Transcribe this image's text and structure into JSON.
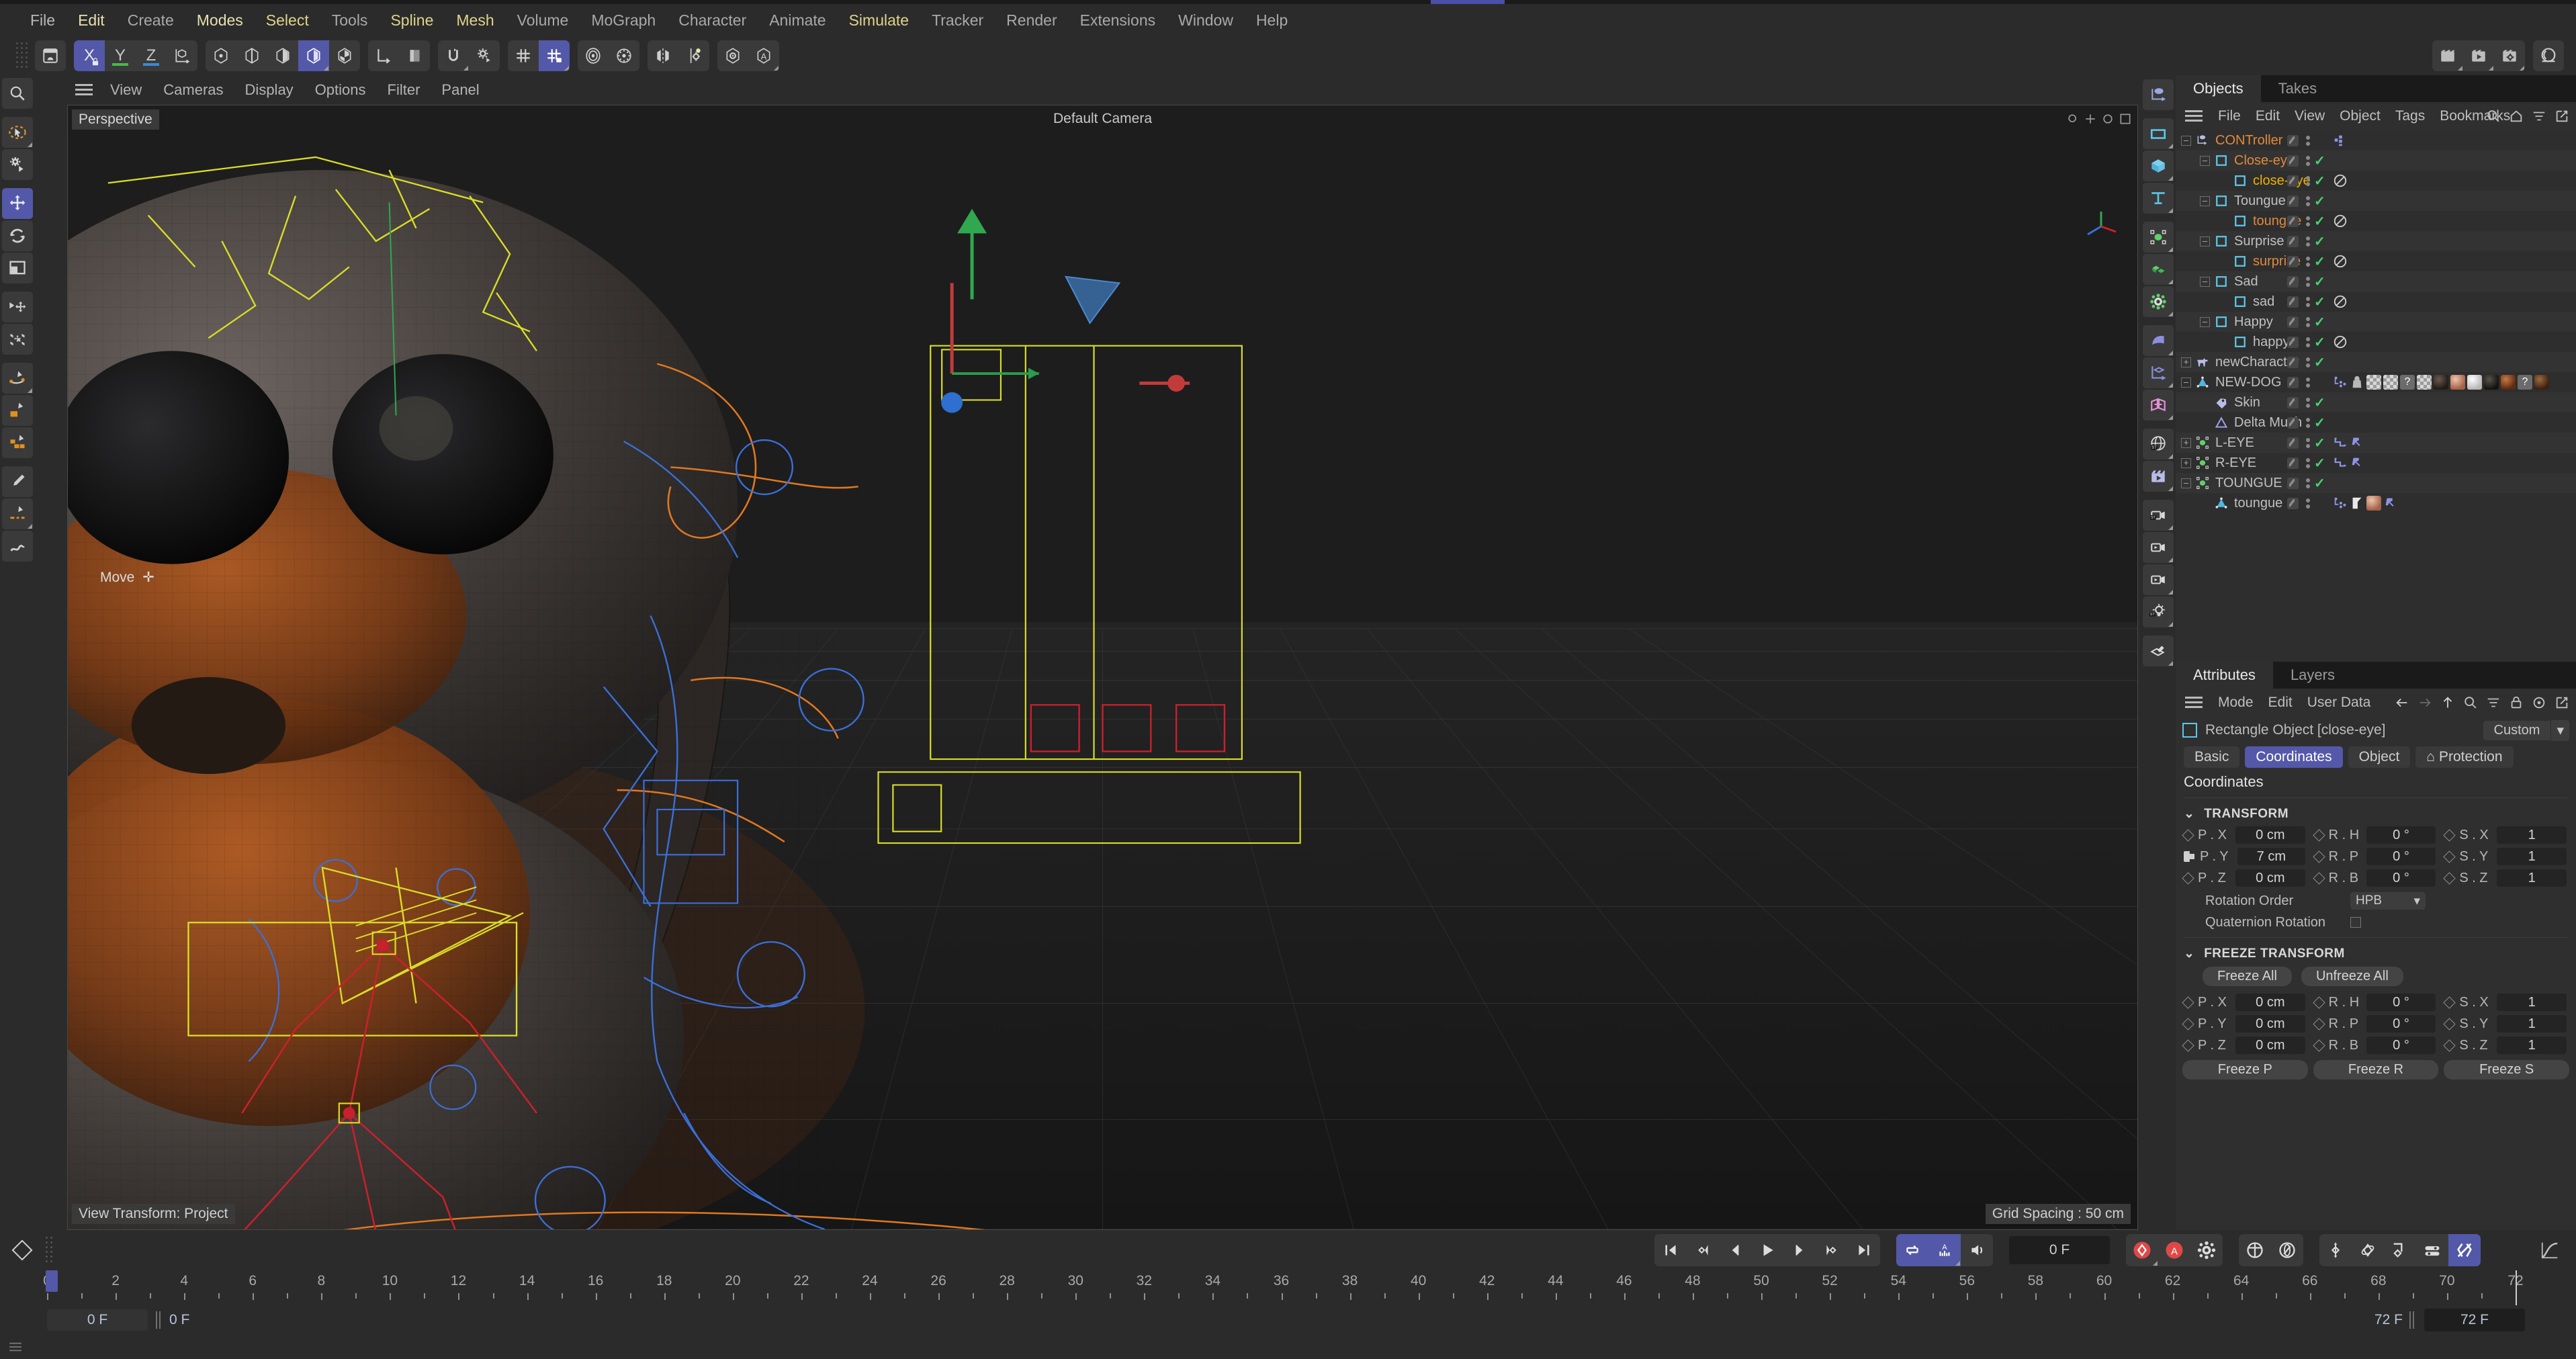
{
  "app": {
    "menubar": [
      {
        "label": "File",
        "color": "#b9b9b9"
      },
      {
        "label": "Edit",
        "color": "#e8e0b0"
      },
      {
        "label": "Create",
        "color": "#a9a9a9"
      },
      {
        "label": "Modes",
        "color": "#e8e0b0"
      },
      {
        "label": "Select",
        "color": "#e0d48a"
      },
      {
        "label": "Tools",
        "color": "#a9a9a9"
      },
      {
        "label": "Spline",
        "color": "#e0d48a"
      },
      {
        "label": "Mesh",
        "color": "#e0d48a"
      },
      {
        "label": "Volume",
        "color": "#a9a9a9"
      },
      {
        "label": "MoGraph",
        "color": "#a9a9a9"
      },
      {
        "label": "Character",
        "color": "#a9a9a9"
      },
      {
        "label": "Animate",
        "color": "#a9a9a9"
      },
      {
        "label": "Simulate",
        "color": "#e0d48a"
      },
      {
        "label": "Tracker",
        "color": "#a9a9a9"
      },
      {
        "label": "Render",
        "color": "#a9a9a9"
      },
      {
        "label": "Extensions",
        "color": "#a9a9a9"
      },
      {
        "label": "Window",
        "color": "#a9a9a9"
      },
      {
        "label": "Help",
        "color": "#a9a9a9"
      }
    ]
  },
  "toolbar": {
    "axis_x": "X",
    "axis_y": "Y",
    "axis_z": "Z"
  },
  "viewport": {
    "menu": [
      "View",
      "Cameras",
      "Display",
      "Options",
      "Filter",
      "Panel"
    ],
    "label": "Perspective",
    "camera": "Default Camera",
    "grid_spacing": "Grid Spacing : 50 cm",
    "view_transform": "View Transform: Project",
    "active_tool": "Move"
  },
  "objects_panel": {
    "tabs": [
      {
        "label": "Objects",
        "active": true
      },
      {
        "label": "Takes",
        "active": false
      }
    ],
    "menu": [
      "File",
      "Edit",
      "View",
      "Object",
      "Tags",
      "Bookmarks"
    ],
    "rows": [
      {
        "name": "CONTroller",
        "depth": 0,
        "color": "#e08a3c",
        "icon": "null-object-icon",
        "expander": "minus",
        "check": false,
        "tags": [
          "mograph-small"
        ]
      },
      {
        "name": "Close-eye",
        "depth": 1,
        "color": "#e08a3c",
        "icon": "rectangle-spline-icon",
        "expander": "minus",
        "check": true,
        "tags": []
      },
      {
        "name": "close-eye",
        "depth": 2,
        "color": "#f0b000",
        "icon": "rectangle-spline-icon",
        "expander": "none",
        "check": true,
        "tags": [
          "no-entry"
        ],
        "selected": true
      },
      {
        "name": "Toungue",
        "depth": 1,
        "color": "#c0c0c0",
        "icon": "rectangle-spline-icon",
        "expander": "minus",
        "check": true,
        "tags": []
      },
      {
        "name": "toungue",
        "depth": 2,
        "color": "#e08a3c",
        "icon": "rectangle-spline-icon",
        "expander": "none",
        "check": true,
        "tags": [
          "no-entry"
        ]
      },
      {
        "name": "Surprise",
        "depth": 1,
        "color": "#c0c0c0",
        "icon": "rectangle-spline-icon",
        "expander": "minus",
        "check": true,
        "tags": []
      },
      {
        "name": "surprise",
        "depth": 2,
        "color": "#e08a3c",
        "icon": "rectangle-spline-icon",
        "expander": "none",
        "check": true,
        "tags": [
          "no-entry"
        ]
      },
      {
        "name": "Sad",
        "depth": 1,
        "color": "#c0c0c0",
        "icon": "rectangle-spline-icon",
        "expander": "minus",
        "check": true,
        "tags": []
      },
      {
        "name": "sad",
        "depth": 2,
        "color": "#c0c0c0",
        "icon": "rectangle-spline-icon",
        "expander": "none",
        "check": true,
        "tags": [
          "no-entry"
        ]
      },
      {
        "name": "Happy",
        "depth": 1,
        "color": "#c0c0c0",
        "icon": "rectangle-spline-icon",
        "expander": "minus",
        "check": true,
        "tags": []
      },
      {
        "name": "happy",
        "depth": 2,
        "color": "#c0c0c0",
        "icon": "rectangle-spline-icon",
        "expander": "none",
        "check": true,
        "tags": [
          "no-entry"
        ]
      },
      {
        "name": "newCharacter",
        "depth": 0,
        "color": "#c0c0c0",
        "icon": "character-icon",
        "expander": "plus",
        "check": true,
        "tags": []
      },
      {
        "name": "NEW-DOG",
        "depth": 0,
        "color": "#c0c0c0",
        "icon": "polygon-object-icon",
        "expander": "minus",
        "check": false,
        "tags": [
          "mograph",
          "bag",
          "checker",
          "tex1",
          "question",
          "tex2",
          "mat-dark",
          "mat-skin",
          "mat-white",
          "mat-black",
          "mat-brown",
          "question2",
          "mat-brown2"
        ]
      },
      {
        "name": "Skin",
        "depth": 1,
        "color": "#c0c0c0",
        "icon": "skin-tag-icon",
        "expander": "none",
        "check": true,
        "tags": []
      },
      {
        "name": "Delta Mush",
        "depth": 1,
        "color": "#c0c0c0",
        "icon": "delta-mush-icon",
        "expander": "none",
        "check": true,
        "tags": []
      },
      {
        "name": "L-EYE",
        "depth": 0,
        "color": "#c0c0c0",
        "icon": "null-point-icon",
        "expander": "plus",
        "check": true,
        "tags": [
          "xpresso",
          "pin"
        ]
      },
      {
        "name": "R-EYE",
        "depth": 0,
        "color": "#c0c0c0",
        "icon": "null-point-icon",
        "expander": "plus",
        "check": true,
        "tags": [
          "xpresso",
          "pin"
        ]
      },
      {
        "name": "TOUNGUE",
        "depth": 0,
        "color": "#c0c0c0",
        "icon": "null-point-icon",
        "expander": "minus",
        "check": true,
        "tags": []
      },
      {
        "name": "toungue",
        "depth": 1,
        "color": "#c0c0c0",
        "icon": "polygon-object-icon",
        "expander": "none",
        "check": false,
        "tags": [
          "mograph",
          "flag",
          "mat-skin",
          "pin"
        ]
      }
    ]
  },
  "attributes_panel": {
    "tabs": [
      {
        "label": "Attributes",
        "active": true
      },
      {
        "label": "Layers",
        "active": false
      }
    ],
    "menu": [
      "Mode",
      "Edit",
      "User Data"
    ],
    "object_title": "Rectangle Object [close-eye]",
    "preset": "Custom",
    "tabs2": [
      {
        "label": "Basic",
        "sel": false
      },
      {
        "label": "Coordinates",
        "sel": true
      },
      {
        "label": "Object",
        "sel": false
      },
      {
        "label": "Protection",
        "sel": false,
        "icon": "lock-icon"
      }
    ],
    "section_title": "Coordinates",
    "transform": {
      "header": "TRANSFORM",
      "rows": [
        {
          "plabel": "P . X",
          "pvalue": "0 cm",
          "rlabel": "R . H",
          "rvalue": "0 °",
          "slabel": "S . X",
          "svalue": "1",
          "pkey": "diamond"
        },
        {
          "plabel": "P . Y",
          "pvalue": "7 cm",
          "rlabel": "R . P",
          "rvalue": "0 °",
          "slabel": "S . Y",
          "svalue": "1",
          "pkey": "track"
        },
        {
          "plabel": "P . Z",
          "pvalue": "0 cm",
          "rlabel": "R . B",
          "rvalue": "0 °",
          "slabel": "S . Z",
          "svalue": "1",
          "pkey": "diamond"
        }
      ],
      "rotation_order_label": "Rotation Order",
      "rotation_order_value": "HPB",
      "quaternion_label": "Quaternion Rotation"
    },
    "freeze": {
      "header": "FREEZE TRANSFORM",
      "freeze_all": "Freeze All",
      "unfreeze_all": "Unfreeze All",
      "rows": [
        {
          "plabel": "P . X",
          "pvalue": "0 cm",
          "rlabel": "R . H",
          "rvalue": "0 °",
          "slabel": "S . X",
          "svalue": "1"
        },
        {
          "plabel": "P . Y",
          "pvalue": "0 cm",
          "rlabel": "R . P",
          "rvalue": "0 °",
          "slabel": "S . Y",
          "svalue": "1"
        },
        {
          "plabel": "P . Z",
          "pvalue": "0 cm",
          "rlabel": "R . B",
          "rvalue": "0 °",
          "slabel": "S . Z",
          "svalue": "1"
        }
      ],
      "freeze_p": "Freeze P",
      "freeze_r": "Freeze R",
      "freeze_s": "Freeze S"
    }
  },
  "timeline": {
    "current_frame_field": "0 F",
    "start_frame": "0 F",
    "preview_min": "0 F",
    "end_frame": "72 F",
    "preview_max": "72 F",
    "ticks": [
      0,
      2,
      4,
      6,
      8,
      10,
      12,
      14,
      16,
      18,
      20,
      22,
      24,
      26,
      28,
      30,
      32,
      34,
      36,
      38,
      40,
      42,
      44,
      46,
      48,
      50,
      52,
      54,
      56,
      58,
      60,
      62,
      64,
      66,
      68,
      70,
      72
    ],
    "playhead": 0
  },
  "colors": {
    "accent": "#5358a8",
    "selected_text": "#f0b000",
    "object_orange": "#e08a3c",
    "check_green": "#49d070",
    "panel_bg": "#2b2b2b",
    "tree_bg": "#2e2e2e",
    "record_red": "#e04848"
  }
}
